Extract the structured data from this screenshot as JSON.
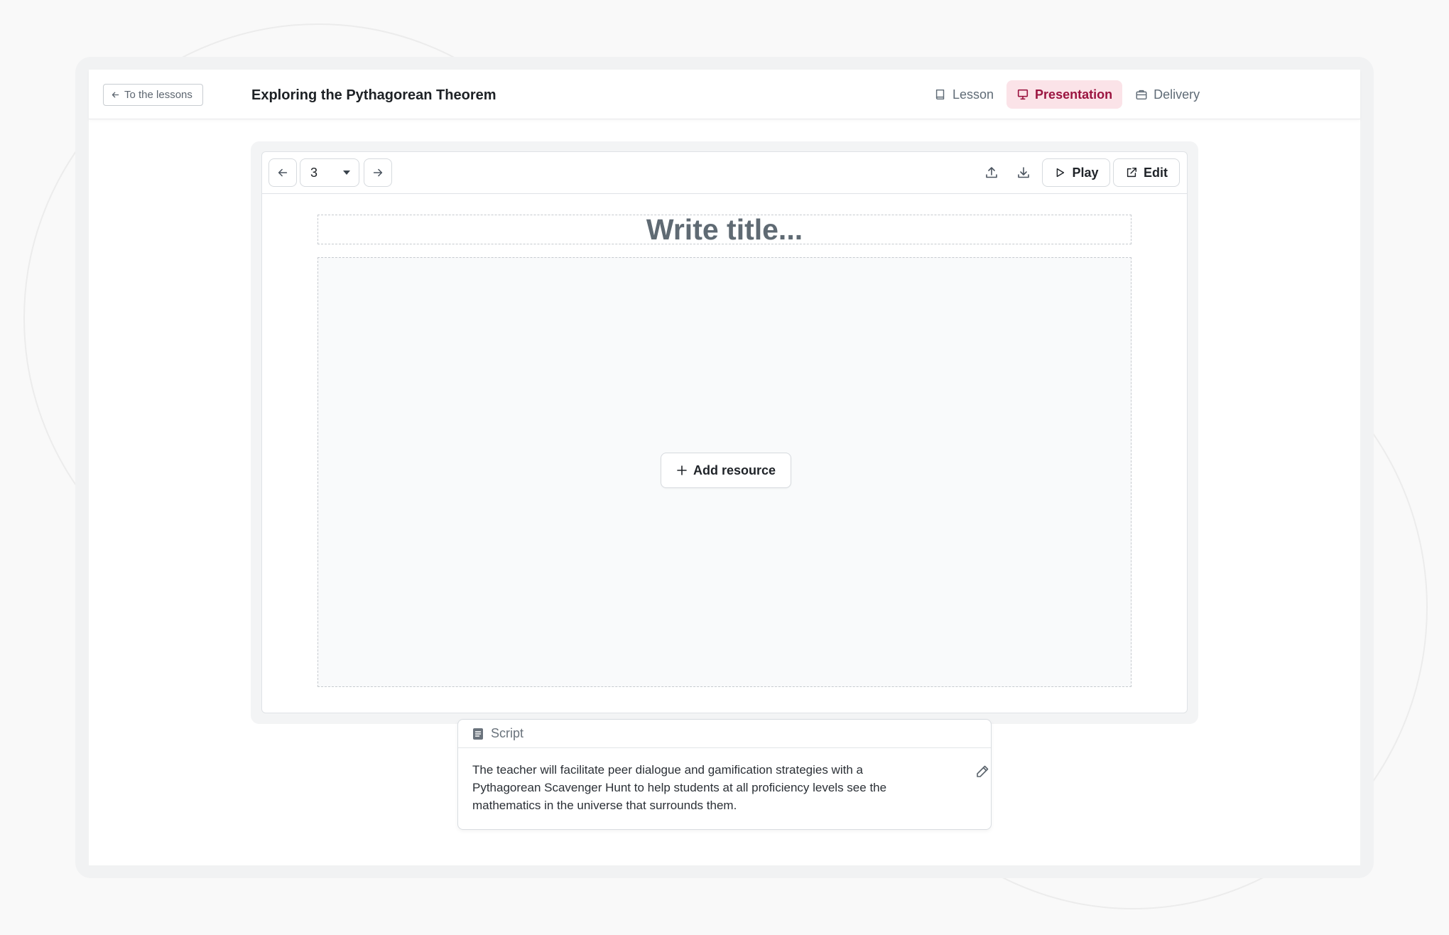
{
  "header": {
    "back_label": "To the lessons",
    "lesson_title": "Exploring the Pythagorean Theorem",
    "tabs": [
      {
        "label": "Lesson",
        "icon": "book-icon",
        "active": false
      },
      {
        "label": "Presentation",
        "icon": "presentation-icon",
        "active": true
      },
      {
        "label": "Delivery",
        "icon": "briefcase-icon",
        "active": false
      }
    ]
  },
  "toolbar": {
    "current_slide": "3",
    "play_label": "Play",
    "edit_label": "Edit"
  },
  "slide": {
    "title_placeholder": "Write title...",
    "add_resource_label": "Add resource"
  },
  "script": {
    "heading": "Script",
    "text": "The teacher will facilitate peer dialogue and gamification strategies with a Pythagorean Scavenger Hunt to help students at all proficiency levels see the mathematics in the universe that surrounds them."
  },
  "colors": {
    "accent": "#9b1440",
    "accent_bg": "#fbe3e8"
  }
}
